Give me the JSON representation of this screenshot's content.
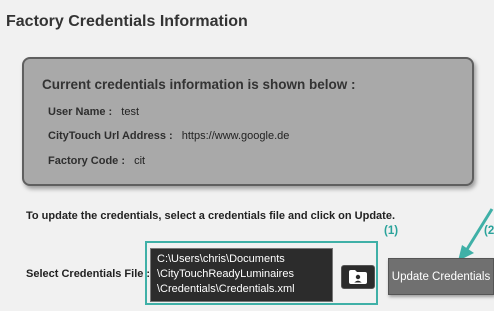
{
  "page": {
    "title": "Factory Credentials Information"
  },
  "info": {
    "heading": "Current credentials information is shown below :",
    "rows": [
      {
        "label": "User Name :",
        "value": "test"
      },
      {
        "label": "CityTouch Url Address :",
        "value": "https://www.google.de"
      },
      {
        "label": "Factory Code :",
        "value": "cit"
      }
    ]
  },
  "update": {
    "hint": "To update the credentials, select a credentials file and click on Update.",
    "select_label": "Select Credentials File :",
    "file_path_lines": [
      "C:\\Users\\chris\\Documents",
      "\\CityTouchReadyLuminaires",
      "\\Credentials\\Credentials.xml"
    ],
    "update_button_label": "Update Credentials",
    "browse_icon": "folder-user-icon"
  },
  "annotations": {
    "step1": "(1)",
    "step2": "(2"
  },
  "colors": {
    "accent_teal": "#3fb0a7",
    "info_box_bg": "#a9a9a9",
    "button_bg": "#707070",
    "path_box_bg": "#2c2c2c"
  }
}
